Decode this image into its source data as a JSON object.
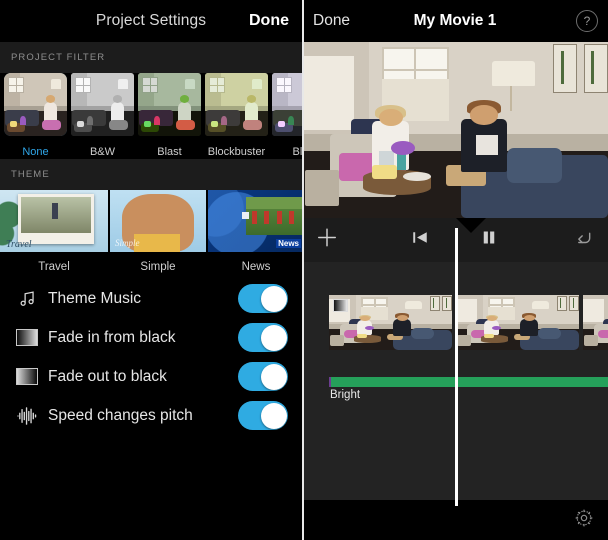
{
  "left_panel": {
    "nav": {
      "title": "Project Settings",
      "done_label": "Done"
    },
    "filter_section": {
      "header": "PROJECT FILTER"
    },
    "filters": [
      {
        "label": "None",
        "selected": true
      },
      {
        "label": "B&W",
        "selected": false
      },
      {
        "label": "Blast",
        "selected": false
      },
      {
        "label": "Blockbuster",
        "selected": false
      },
      {
        "label": "Blue",
        "selected": false
      }
    ],
    "theme_section": {
      "header": "THEME"
    },
    "themes": [
      {
        "label": "Travel",
        "overlay_text": "Travel"
      },
      {
        "label": "Simple",
        "overlay_text": "Simple"
      },
      {
        "label": "News",
        "overlay_text": "News"
      }
    ],
    "settings": [
      {
        "icon": "music-note-icon",
        "label": "Theme Music",
        "on": true
      },
      {
        "icon": "fade-in-icon",
        "label": "Fade in from black",
        "on": true
      },
      {
        "icon": "fade-out-icon",
        "label": "Fade out to black",
        "on": true
      },
      {
        "icon": "waveform-icon",
        "label": "Speed changes pitch",
        "on": true
      }
    ]
  },
  "right_panel": {
    "nav": {
      "done_label": "Done",
      "title": "My Movie 1",
      "help_label": "?"
    },
    "toolbar": {
      "add_label": "+",
      "skip_to_start": "skip-to-start-icon",
      "pause": "pause-icon",
      "undo": "undo-icon"
    },
    "timeline": {
      "audio_track_label": "Bright",
      "settings_icon": "gear-icon"
    }
  },
  "colors": {
    "accent_blue": "#2fabe2",
    "audio_green": "#25a05a",
    "panel_dark": "#000000",
    "section_header_bg": "#1c1c1c",
    "timeline_bg": "#232323"
  }
}
